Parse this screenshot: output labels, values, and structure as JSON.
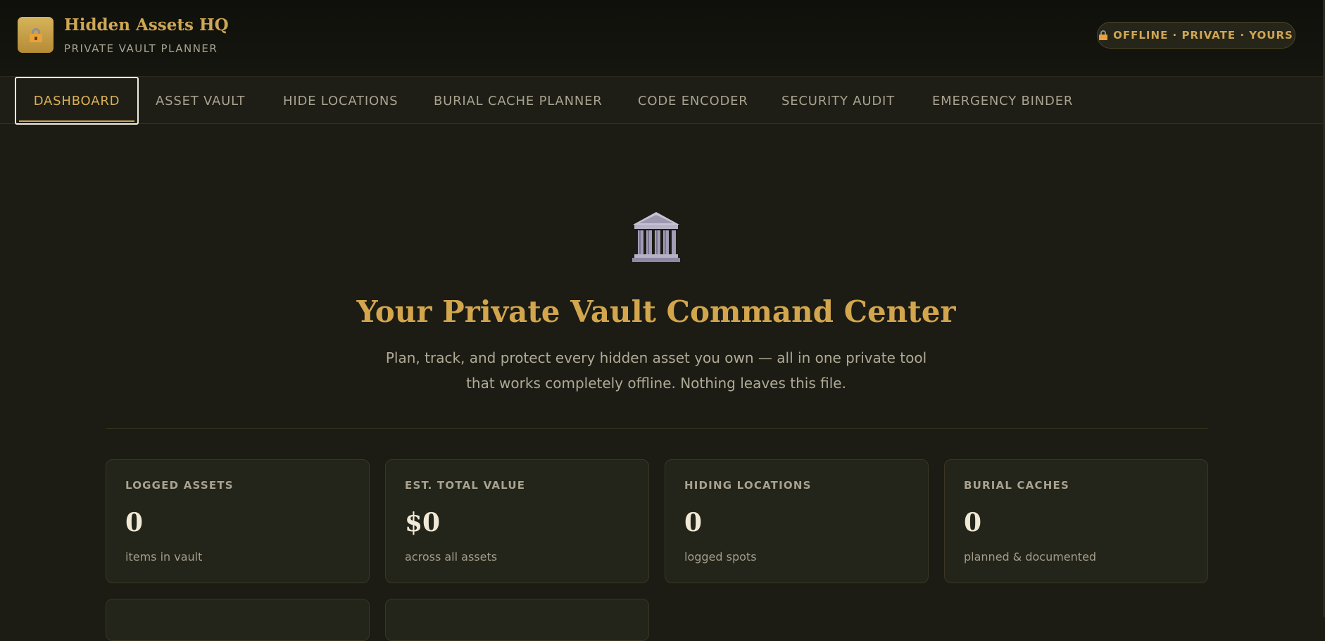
{
  "header": {
    "title": "Hidden Assets HQ",
    "subtitle": "PRIVATE VAULT PLANNER",
    "status": "OFFLINE · PRIVATE · YOURS"
  },
  "nav": {
    "tabs": [
      {
        "label": "DASHBOARD",
        "active": true
      },
      {
        "label": "ASSET VAULT"
      },
      {
        "label": "HIDE LOCATIONS"
      },
      {
        "label": "BURIAL CACHE PLANNER"
      },
      {
        "label": "CODE ENCODER"
      },
      {
        "label": "SECURITY AUDIT"
      },
      {
        "label": "EMERGENCY BINDER"
      }
    ]
  },
  "hero": {
    "icon": "classical-building-icon",
    "title": "Your Private Vault Command Center",
    "line1": "Plan, track, and protect every hidden asset you own — all in one private tool",
    "line2": "that works completely offline. Nothing leaves this file."
  },
  "stats": [
    {
      "label": "LOGGED ASSETS",
      "value": "0",
      "desc": "items in vault"
    },
    {
      "label": "EST. TOTAL VALUE",
      "value": "$0",
      "desc": "across all assets"
    },
    {
      "label": "HIDING LOCATIONS",
      "value": "0",
      "desc": "logged spots"
    },
    {
      "label": "BURIAL CACHES",
      "value": "0",
      "desc": "planned & documented"
    }
  ],
  "colors": {
    "accent": "#cfa654",
    "background": "#1c1c14",
    "card": "#23241a"
  }
}
